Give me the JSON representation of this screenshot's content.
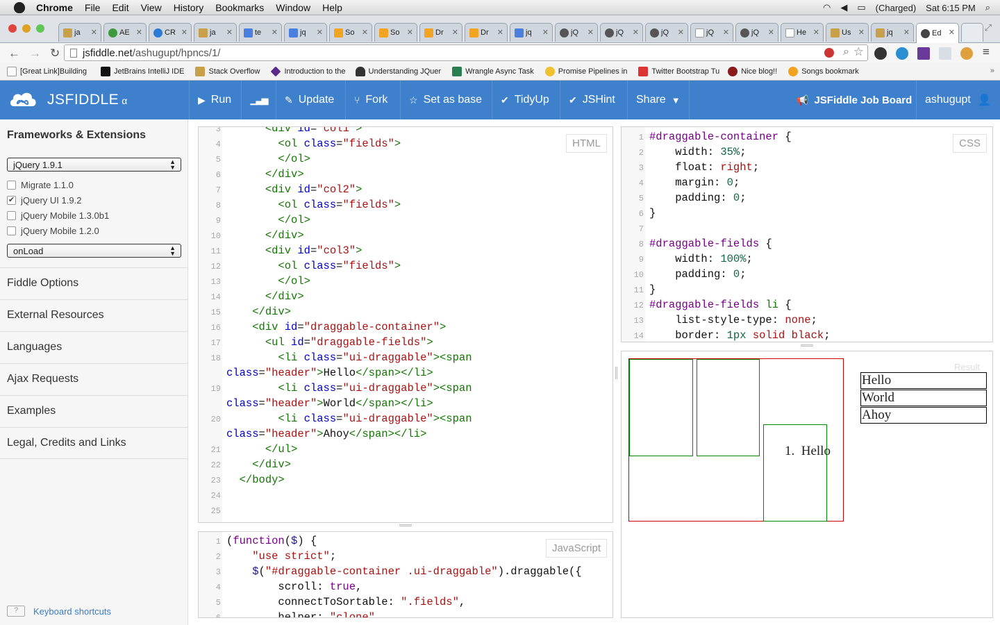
{
  "menubar": {
    "app": "Chrome",
    "menus": [
      "File",
      "Edit",
      "View",
      "History",
      "Bookmarks",
      "Window",
      "Help"
    ],
    "battery": "(Charged)",
    "clock": "Sat 6:15 PM"
  },
  "tabs": [
    {
      "label": "ja"
    },
    {
      "label": "AE"
    },
    {
      "label": "CR"
    },
    {
      "label": "ja"
    },
    {
      "label": "te"
    },
    {
      "label": "jq"
    },
    {
      "label": "So"
    },
    {
      "label": "So"
    },
    {
      "label": "Dr"
    },
    {
      "label": "Dr"
    },
    {
      "label": "jq"
    },
    {
      "label": "jQ"
    },
    {
      "label": "jQ"
    },
    {
      "label": "jQ"
    },
    {
      "label": "jQ"
    },
    {
      "label": "jQ"
    },
    {
      "label": "He"
    },
    {
      "label": "Us"
    },
    {
      "label": "jq"
    },
    {
      "label": "Ed"
    }
  ],
  "url": {
    "host": "jsfiddle.net",
    "path": "/ashugupt/hpncs/1/"
  },
  "bookmarks": [
    "[Great Link]Building",
    "JetBrains IntelliJ IDE",
    "Stack Overflow",
    "Introduction to the",
    "Understanding JQuer",
    "Wrangle Async Task",
    "Promise Pipelines in",
    "Twitter Bootstrap Tu",
    "Nice blog!!",
    "Songs bookmark"
  ],
  "header": {
    "brand": "JSFIDDLE",
    "alpha": "α",
    "run": "Run",
    "update": "Update",
    "fork": "Fork",
    "setbase": "Set as base",
    "tidyup": "TidyUp",
    "jshint": "JSHint",
    "share": "Share",
    "jobboard": "JSFiddle Job Board",
    "user": "ashugupt"
  },
  "sidebar": {
    "title": "Frameworks & Extensions",
    "framework": "jQuery 1.9.1",
    "extensions": [
      {
        "label": "Migrate 1.1.0",
        "checked": false
      },
      {
        "label": "jQuery UI 1.9.2",
        "checked": true
      },
      {
        "label": "jQuery Mobile 1.3.0b1",
        "checked": false
      },
      {
        "label": "jQuery Mobile 1.2.0",
        "checked": false
      }
    ],
    "load": "onLoad",
    "sections": [
      "Fiddle Options",
      "External Resources",
      "Languages",
      "Ajax Requests",
      "Examples",
      "Legal, Credits and Links"
    ],
    "shortcut_key": "?",
    "shortcuts": "Keyboard shortcuts"
  },
  "html_panel": {
    "label": "HTML"
  },
  "css_panel": {
    "label": "CSS"
  },
  "js_panel": {
    "label": "JavaScript"
  },
  "result_panel": {
    "label": "Result",
    "list_number": "1.",
    "list_item": "Hello",
    "fields": [
      "Hello",
      "World",
      "Ahoy"
    ]
  }
}
